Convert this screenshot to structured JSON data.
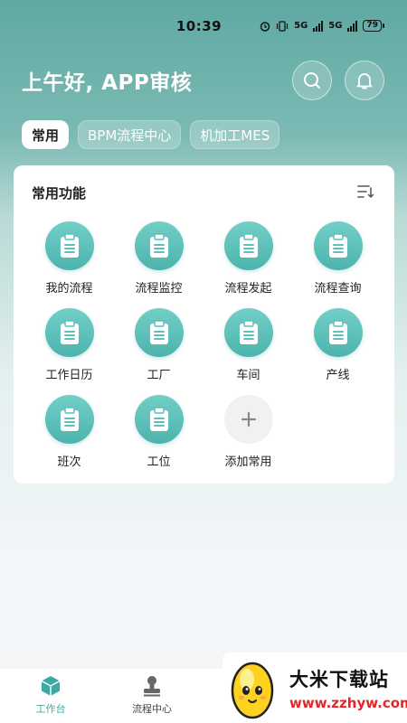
{
  "status_bar": {
    "time": "10:39",
    "battery": "79",
    "signal_1": "5G",
    "signal_2": "5G"
  },
  "header": {
    "greeting": "上午好, APP审核"
  },
  "tabs": [
    {
      "label": "常用",
      "active": true
    },
    {
      "label": "BPM流程中心",
      "active": false
    },
    {
      "label": "机加工MES",
      "active": false
    }
  ],
  "card": {
    "title": "常用功能",
    "items": [
      {
        "label": "我的流程",
        "icon": "clipboard-icon"
      },
      {
        "label": "流程监控",
        "icon": "clipboard-icon"
      },
      {
        "label": "流程发起",
        "icon": "clipboard-icon"
      },
      {
        "label": "流程查询",
        "icon": "clipboard-icon"
      },
      {
        "label": "工作日历",
        "icon": "clipboard-icon"
      },
      {
        "label": "工厂",
        "icon": "clipboard-icon"
      },
      {
        "label": "车间",
        "icon": "clipboard-icon"
      },
      {
        "label": "产线",
        "icon": "clipboard-icon"
      },
      {
        "label": "班次",
        "icon": "clipboard-icon"
      },
      {
        "label": "工位",
        "icon": "clipboard-icon"
      },
      {
        "label": "添加常用",
        "icon": "plus-icon"
      }
    ]
  },
  "bottom_nav": [
    {
      "label": "工作台",
      "icon": "cube-icon",
      "active": true
    },
    {
      "label": "流程中心",
      "icon": "stamp-icon",
      "active": false
    }
  ],
  "watermark": {
    "title": "大米下载站",
    "url": "www.zzhyw.com"
  },
  "colors": {
    "accent": "#3ea9a2",
    "header_bg": "#5fa9a2",
    "icon_bg": "#5cc1ba"
  }
}
